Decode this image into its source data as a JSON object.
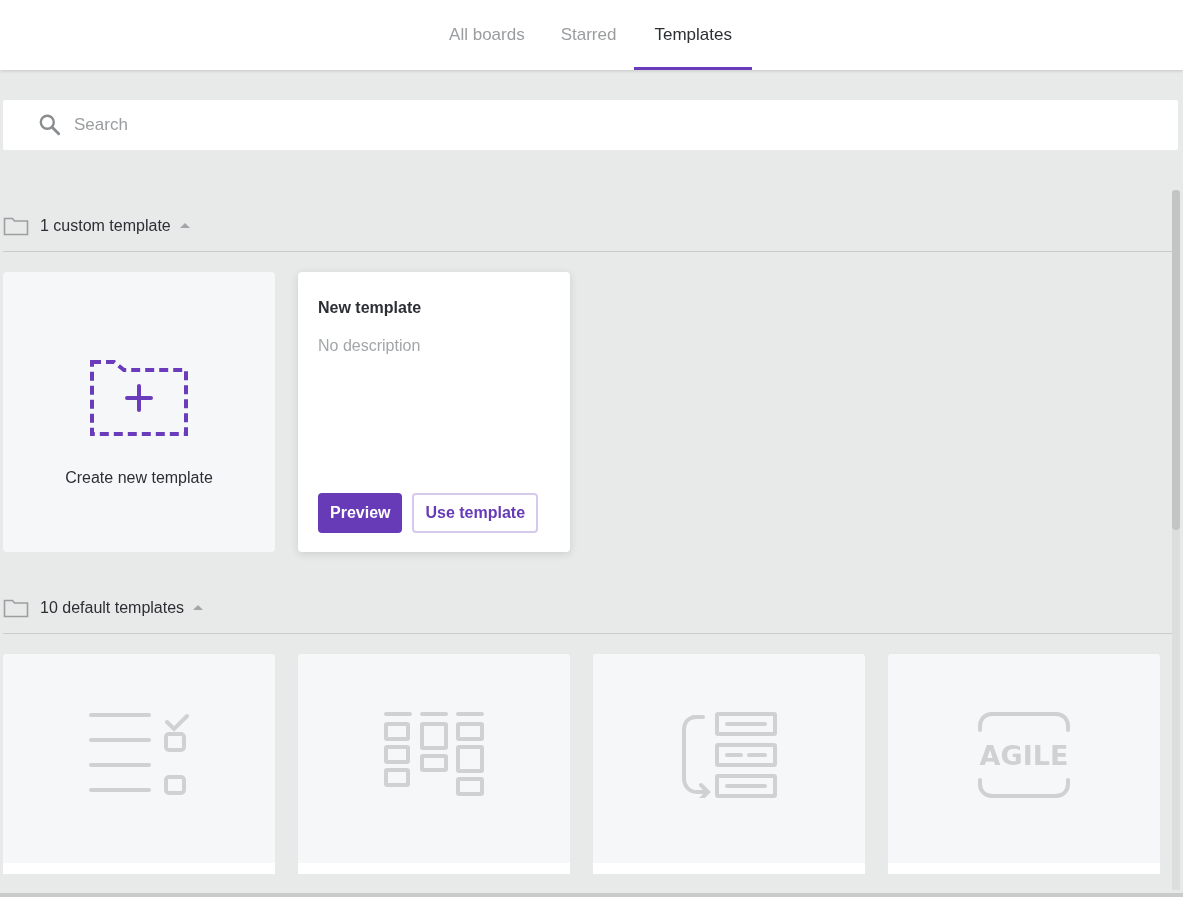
{
  "tabs": [
    {
      "label": "All boards",
      "selected": false
    },
    {
      "label": "Starred",
      "selected": false
    },
    {
      "label": "Templates",
      "selected": true
    }
  ],
  "search": {
    "placeholder": "Search"
  },
  "sections": [
    {
      "title": "1 custom template",
      "expanded": true,
      "items": [
        {
          "kind": "create",
          "label": "Create new template"
        },
        {
          "kind": "template",
          "title": "New template",
          "description": "No description",
          "buttons": [
            "Preview",
            "Use template"
          ]
        }
      ]
    },
    {
      "title": "10 default templates",
      "expanded": true,
      "items": [
        {
          "kind": "checklist"
        },
        {
          "kind": "grid"
        },
        {
          "kind": "flow"
        },
        {
          "kind": "agile",
          "icon_text": "AGILE"
        }
      ]
    }
  ]
}
